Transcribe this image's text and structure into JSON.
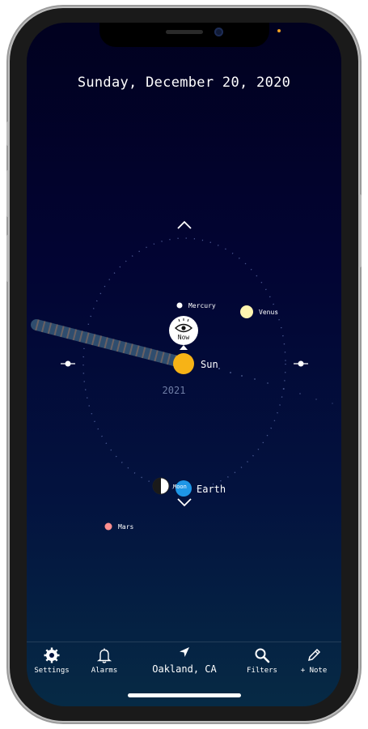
{
  "header": {
    "date": "Sunday, December 20, 2020"
  },
  "orbit": {
    "year_label": "2021",
    "now_label": "Now",
    "sun_label": "Sun",
    "earth_label": "Earth",
    "moon_label": "Moon",
    "planets": [
      {
        "name": "Mercury",
        "color": "#ffffff"
      },
      {
        "name": "Venus",
        "color": "#fff4b0"
      },
      {
        "name": "Mars",
        "color": "#ff8f8f"
      }
    ],
    "colors": {
      "sun": "#f7b316",
      "earth": "#1e96e6",
      "trail": "#3b6b86"
    }
  },
  "tabbar": {
    "settings_label": "Settings",
    "alarms_label": "Alarms",
    "location_label": "Oakland, CA",
    "filters_label": "Filters",
    "note_label": "+ Note"
  }
}
